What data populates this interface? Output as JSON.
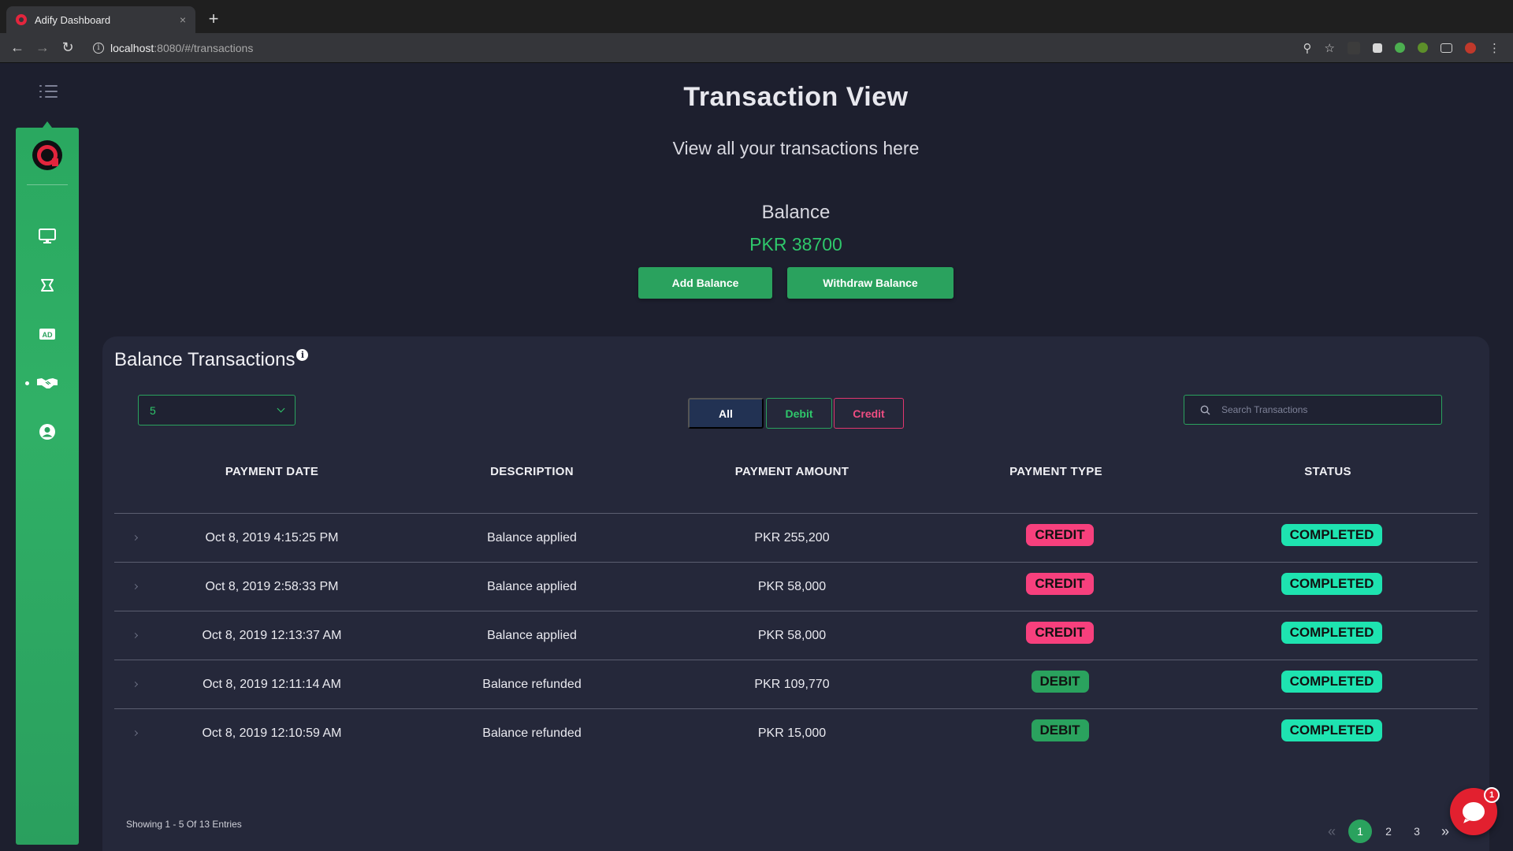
{
  "browser": {
    "tab_title": "Adify Dashboard",
    "tab_close": "×",
    "new_tab": "+",
    "url_host": "localhost",
    "url_rest": ":8080/#/transactions"
  },
  "header": {
    "title": "Transaction View",
    "subtitle": "View all your transactions here",
    "balance_label": "Balance",
    "balance_value": "PKR 38700",
    "add_balance": "Add Balance",
    "withdraw_balance": "Withdraw Balance"
  },
  "card": {
    "title": "Balance Transactions",
    "info_glyph": "i",
    "page_size": "5",
    "filters": {
      "all": "All",
      "debit": "Debit",
      "credit": "Credit"
    },
    "search_placeholder": "Search Transactions",
    "columns": [
      "PAYMENT DATE",
      "DESCRIPTION",
      "PAYMENT AMOUNT",
      "PAYMENT TYPE",
      "STATUS"
    ],
    "rows": [
      {
        "date": "Oct 8, 2019 4:15:25 PM",
        "description": "Balance applied",
        "amount": "PKR 255,200",
        "type": "CREDIT",
        "status": "COMPLETED"
      },
      {
        "date": "Oct 8, 2019 2:58:33 PM",
        "description": "Balance applied",
        "amount": "PKR 58,000",
        "type": "CREDIT",
        "status": "COMPLETED"
      },
      {
        "date": "Oct 8, 2019 12:13:37 AM",
        "description": "Balance applied",
        "amount": "PKR 58,000",
        "type": "CREDIT",
        "status": "COMPLETED"
      },
      {
        "date": "Oct 8, 2019 12:11:14 AM",
        "description": "Balance refunded",
        "amount": "PKR 109,770",
        "type": "DEBIT",
        "status": "COMPLETED"
      },
      {
        "date": "Oct 8, 2019 12:10:59 AM",
        "description": "Balance refunded",
        "amount": "PKR 15,000",
        "type": "DEBIT",
        "status": "COMPLETED"
      }
    ],
    "entries_text": "Showing 1 - 5 Of 13 Entries",
    "pages": [
      "1",
      "2",
      "3"
    ],
    "prev_glyph": "«",
    "next_glyph": "»"
  },
  "chat": {
    "unread_count": "1"
  },
  "colors": {
    "accent_green": "#2aa25e",
    "credit_pink": "#f7407d",
    "completed_teal": "#1ee3b0",
    "background": "#1d1f2e",
    "card": "#25283a"
  },
  "icons": {
    "sidebar": [
      "menu-list-icon",
      "adify-logo",
      "monitor-icon",
      "campaign-icon",
      "ad-icon",
      "handshake-icon",
      "user-circle-icon"
    ],
    "browser": [
      "back-icon",
      "forward-icon",
      "reload-icon",
      "key-icon",
      "star-icon",
      "menu-dots-icon"
    ]
  }
}
